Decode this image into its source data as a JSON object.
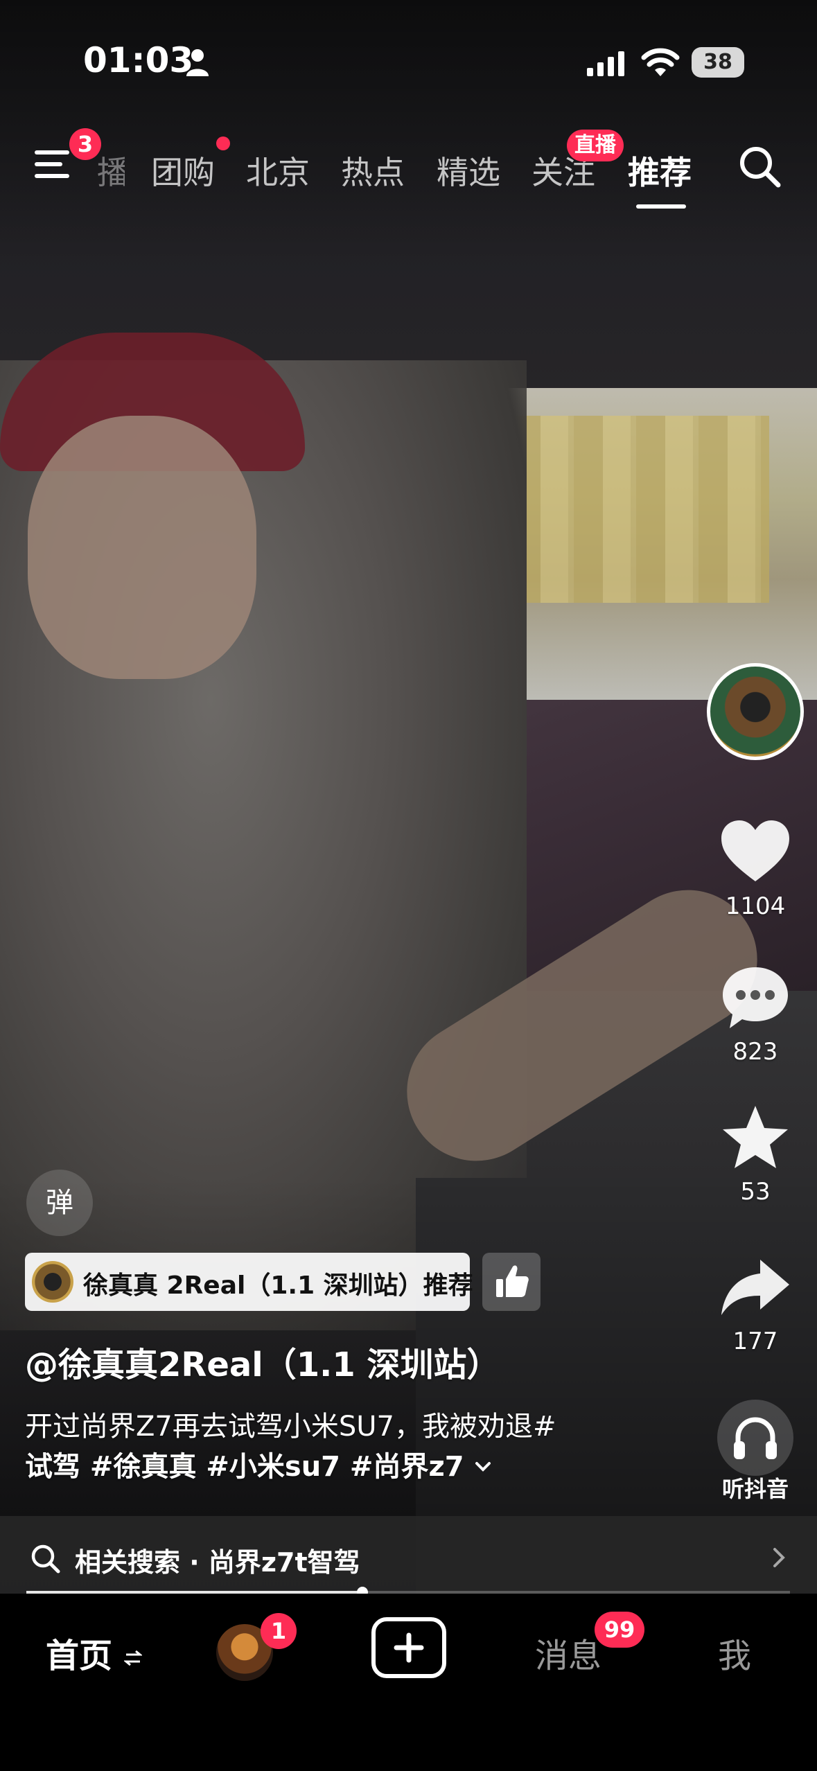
{
  "status_bar": {
    "time": "01:03",
    "battery": "38"
  },
  "top_tabs": {
    "menu_badge": "3",
    "partial_tab": "播",
    "tabs": [
      "团购",
      "北京",
      "热点",
      "精选",
      "关注",
      "推荐"
    ],
    "live_badge": "直播",
    "active_tab": "推荐"
  },
  "rail": {
    "likes": "1104",
    "comments": "823",
    "favorites": "53",
    "shares": "177",
    "listen_label": "听抖音"
  },
  "danmaku_label": "弹",
  "recommend_pill": {
    "text": "徐真真 2Real（1.1 深圳站）推荐"
  },
  "video": {
    "author": "@徐真真2Real（1.1 深圳站）",
    "caption_line1": "开过尚界Z7再去试驾小米SU7，我被劝退#",
    "caption_line2": "试驾 #徐真真 #小米su7 #尚界z7",
    "progress": 0.44
  },
  "related_search": {
    "text": "相关搜索 · 尚界z7t智驾"
  },
  "bottom_nav": {
    "home": "首页",
    "friend_badge": "1",
    "messages": "消息",
    "messages_badge": "99",
    "me": "我"
  },
  "colors": {
    "accent": "#fe2c55",
    "nav_bg": "#000000"
  }
}
